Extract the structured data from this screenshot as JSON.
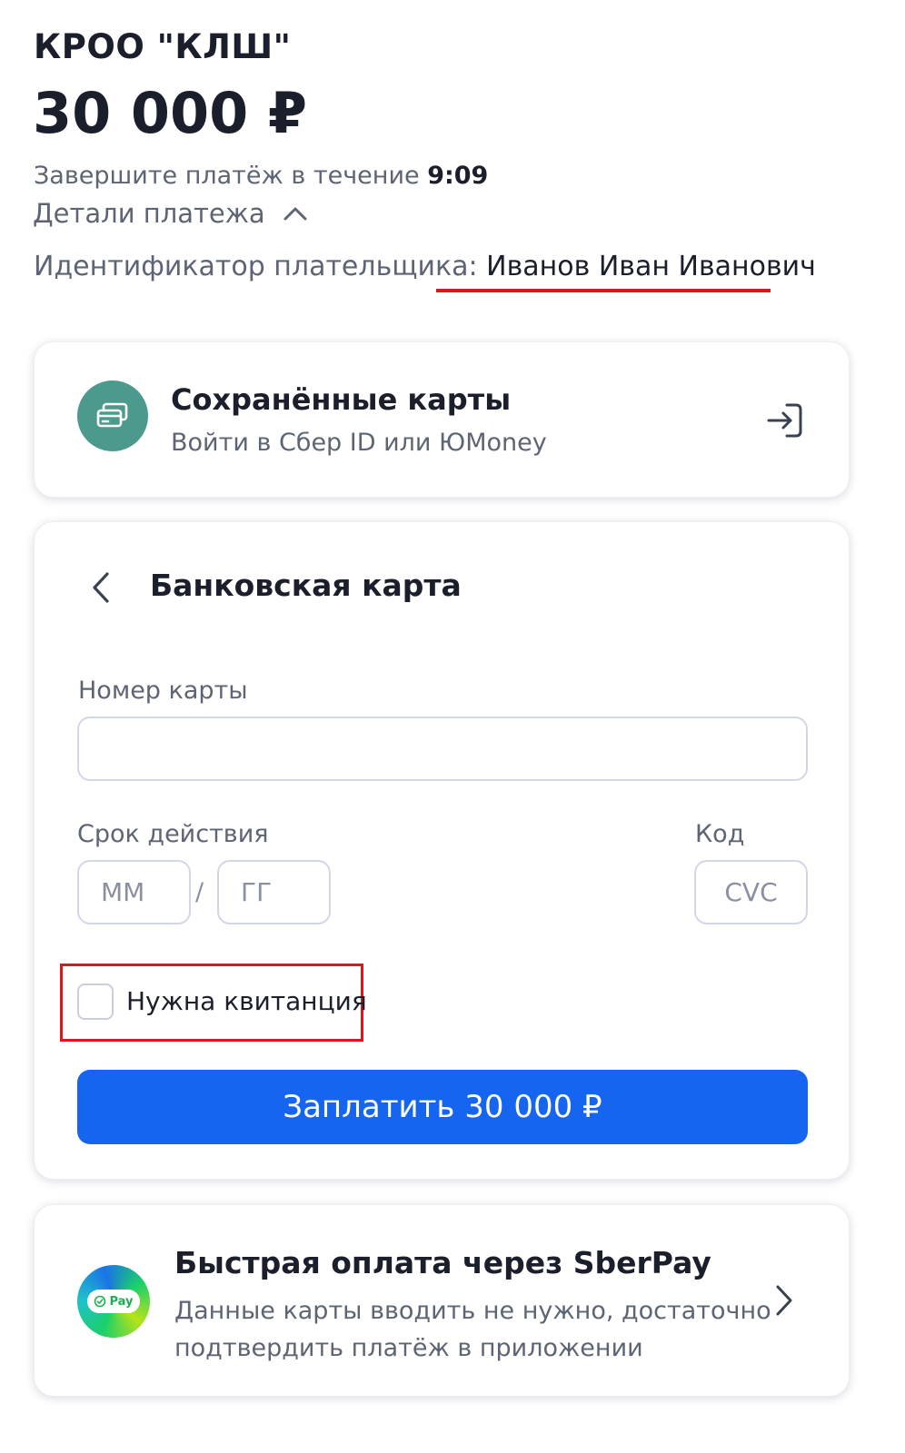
{
  "merchant": {
    "name": "КРОО \"КЛШ\""
  },
  "payment": {
    "amount": "30 000 ₽",
    "timer_prefix": "Завершите платёж в течение ",
    "timer_value": "9:09",
    "details_label": "Детали платежа",
    "payer_label": "Идентификатор плательщика: ",
    "payer_value": "Иванов Иван Иванович"
  },
  "saved_cards": {
    "title": "Сохранённые карты",
    "subtitle": "Войти в Сбер ID или ЮMoney",
    "icon_color": "#4c9a8e"
  },
  "bank_card": {
    "title": "Банковская карта",
    "card_number_label": "Номер карты",
    "card_number_value": "",
    "expiry_label": "Срок действия",
    "month_placeholder": "ММ",
    "separator": "/",
    "year_placeholder": "ГГ",
    "code_label": "Код",
    "cvc_placeholder": "CVC",
    "receipt_label": "Нужна квитанция",
    "receipt_checked": false,
    "pay_button_label": "Заплатить  30 000 ₽",
    "pay_button_color": "#1565f0"
  },
  "sberpay": {
    "title": "Быстрая оплата через SberPay",
    "description": "Данные карты вводить не нужно, достаточно подтвердить платёж в приложении",
    "logo_text": "Pay"
  },
  "colors": {
    "accent": "#1565f0",
    "annotation": "#e0141b",
    "text_primary": "#1b1f2b",
    "text_secondary": "#5d6474"
  }
}
